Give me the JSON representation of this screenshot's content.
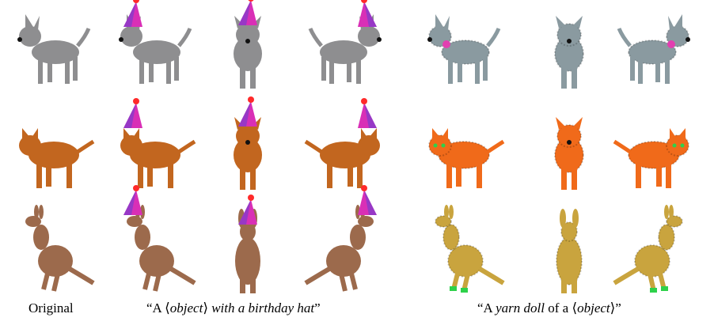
{
  "figure": {
    "rows": [
      "dog",
      "cat",
      "kangaroo"
    ],
    "columns": [
      {
        "group": "original",
        "view": "side-left"
      },
      {
        "group": "birthday-hat",
        "view": "side-left"
      },
      {
        "group": "birthday-hat",
        "view": "front"
      },
      {
        "group": "birthday-hat",
        "view": "side-right"
      },
      {
        "group": "yarn-doll",
        "view": "side-left"
      },
      {
        "group": "yarn-doll",
        "view": "front"
      },
      {
        "group": "yarn-doll",
        "view": "side-right"
      }
    ],
    "colors": {
      "dog_body": "#8e8e90",
      "cat_body": "#c2661f",
      "kangaroo_body": "#9c6a4c",
      "hat": "#d92fb6",
      "hat_shade": "#6a3fd0",
      "pompom": "#ff2a2a",
      "yarn_dog": "#8a9aa0",
      "yarn_cat": "#f06a1a",
      "yarn_kangaroo": "#c9a43e",
      "yarn_eye": "#2ed14a",
      "yarn_collar": "#e23fb0"
    }
  },
  "captions": {
    "original": "Original",
    "hat_prefix": "“A ⟨",
    "hat_object": "object",
    "hat_mid": "⟩ ",
    "hat_suffix": "with a birthday hat",
    "hat_end": "”",
    "yarn_prefix": "“A ",
    "yarn_doll": "yarn doll",
    "yarn_mid": " of a ⟨",
    "yarn_object": "object",
    "yarn_end": "⟩”"
  }
}
